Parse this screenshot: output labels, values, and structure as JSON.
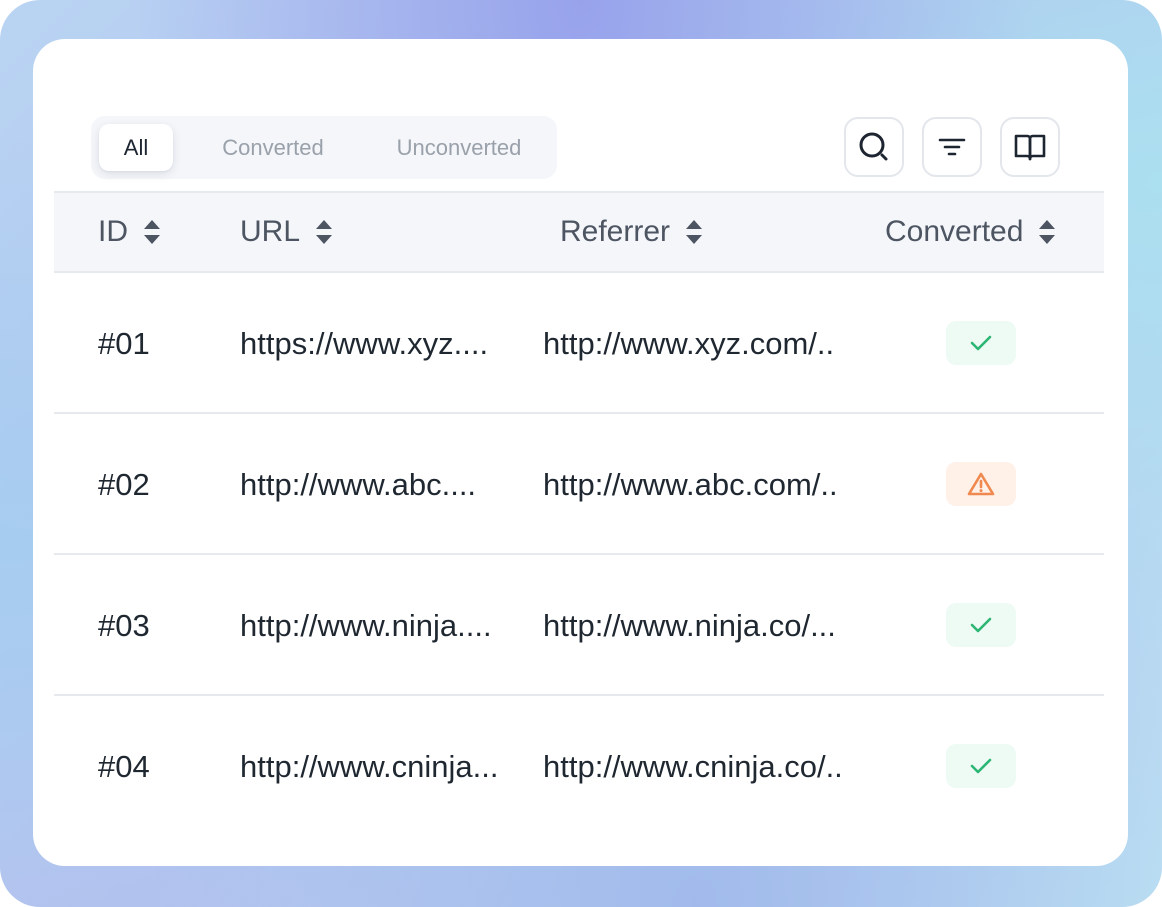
{
  "filter_tabs": [
    {
      "label": "All",
      "active": true
    },
    {
      "label": "Converted",
      "active": false
    },
    {
      "label": "Unconverted",
      "active": false
    }
  ],
  "toolbar": {
    "icons": [
      "search-icon",
      "filter-icon",
      "book-icon"
    ]
  },
  "table": {
    "columns": [
      "ID",
      "URL",
      "Referrer",
      "Converted"
    ],
    "rows": [
      {
        "id": "#01",
        "url": "https://www.xyz....",
        "referrer": "http://www.xyz.com/..",
        "status": "converted",
        "status_icon": "check-icon"
      },
      {
        "id": "#02",
        "url": "http://www.abc....",
        "referrer": "http://www.abc.com/..",
        "status": "warning",
        "status_icon": "warning-icon"
      },
      {
        "id": "#03",
        "url": "http://www.ninja....",
        "referrer": "http://www.ninja.co/...",
        "status": "converted",
        "status_icon": "check-icon"
      },
      {
        "id": "#04",
        "url": "http://www.cninja...",
        "referrer": "http://www.cninja.co/..",
        "status": "converted",
        "status_icon": "check-icon"
      }
    ]
  },
  "colors": {
    "check": "#2bb673",
    "warning": "#f0894e",
    "header_bg": "#f4f6fa"
  }
}
